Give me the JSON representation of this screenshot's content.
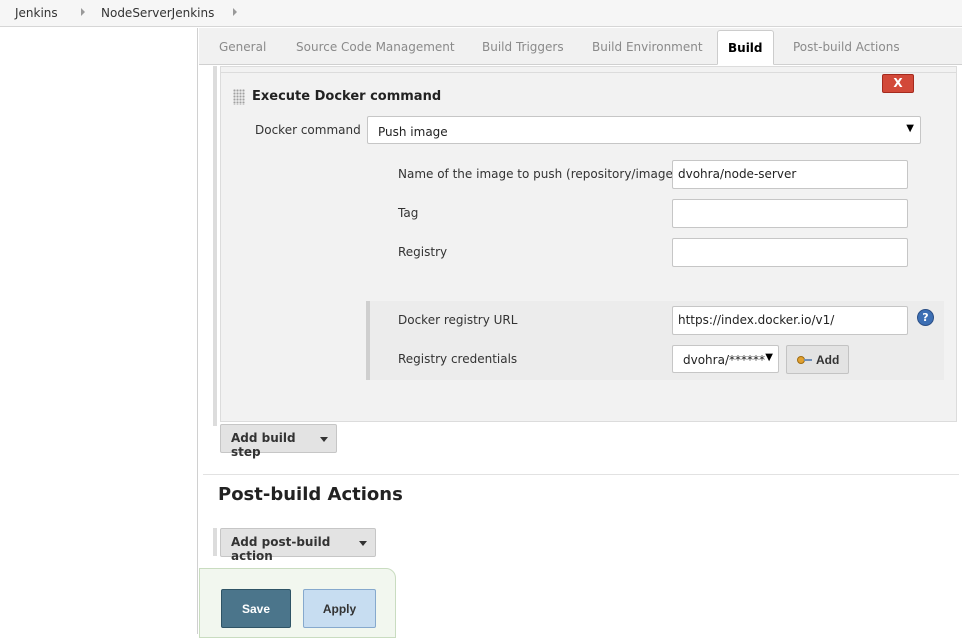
{
  "breadcrumb": {
    "items": [
      "Jenkins",
      "NodeServerJenkins"
    ]
  },
  "tabs": [
    {
      "label": "General",
      "active": false
    },
    {
      "label": "Source Code Management",
      "active": false
    },
    {
      "label": "Build Triggers",
      "active": false
    },
    {
      "label": "Build Environment",
      "active": false
    },
    {
      "label": "Build",
      "active": true
    },
    {
      "label": "Post-build Actions",
      "active": false
    }
  ],
  "build_step": {
    "delete_label": "X",
    "title": "Execute Docker command",
    "docker_command_label": "Docker command",
    "docker_command_value": "Push image",
    "image_name_label": "Name of the image to push (repository/image)",
    "image_name_value": "dvohra/node-server",
    "tag_label": "Tag",
    "tag_value": "",
    "registry_label": "Registry",
    "registry_value": "",
    "registry_url_label": "Docker registry URL",
    "registry_url_value": "https://index.docker.io/v1/",
    "help_label": "?",
    "credentials_label": "Registry credentials",
    "credentials_value": "dvohra/******",
    "add_credentials_label": "Add"
  },
  "add_build_step_label": "Add build step",
  "post_build": {
    "title": "Post-build Actions",
    "add_label": "Add post-build action"
  },
  "footer": {
    "save_label": "Save",
    "apply_label": "Apply"
  },
  "colors": {
    "delete": "#d24939",
    "save": "#4b758b",
    "apply": "#c7ddf1",
    "help": "#3d6fb4"
  }
}
